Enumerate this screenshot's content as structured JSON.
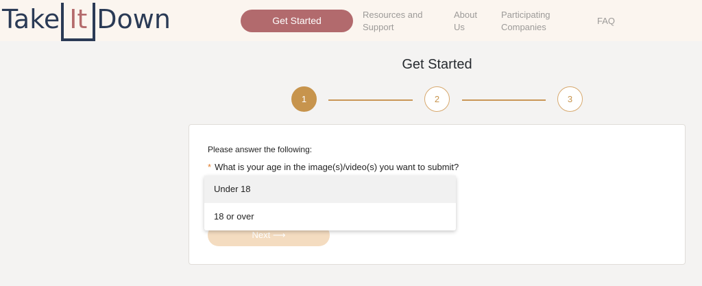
{
  "logo": {
    "part1": "Take",
    "part2": "It",
    "part3": "Down"
  },
  "nav": {
    "cta": "Get Started",
    "links": [
      {
        "line1": "Resources and",
        "line2": "Support"
      },
      {
        "line1": "About",
        "line2": "Us"
      },
      {
        "line1": "Participating",
        "line2": "Companies"
      },
      {
        "line1": "FAQ",
        "line2": ""
      }
    ]
  },
  "page": {
    "title": "Get Started"
  },
  "steps": [
    "1",
    "2",
    "3"
  ],
  "active_step": 1,
  "form": {
    "prompt": "Please answer the following:",
    "required_mark": "*",
    "question": "What is your age in the image(s)/video(s) you want to submit?",
    "options": [
      "Under 18",
      "18 or over"
    ],
    "highlighted_option": "Under 18",
    "next_label": "Next ⟶"
  },
  "colors": {
    "brand_navy": "#2a3a55",
    "brand_rose": "#b26a6d",
    "accent_gold": "#c7944d",
    "header_bg": "#fbf5ef"
  }
}
